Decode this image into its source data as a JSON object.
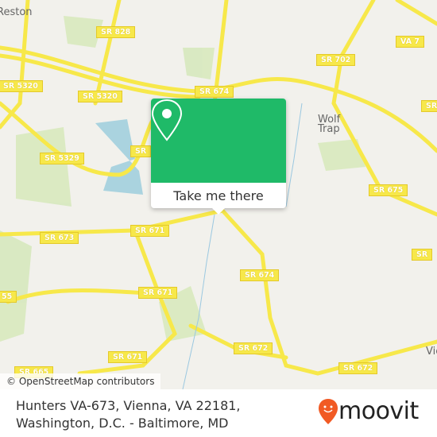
{
  "map": {
    "places": [
      {
        "label": "Reston"
      },
      {
        "label": "Wolf\nTrap"
      },
      {
        "label": "Vie"
      }
    ],
    "shields": [
      "SR 828",
      "VA 7",
      "SR 702",
      "SR 5320",
      "SR 5320",
      "SR 674",
      "SR",
      "SR 5329",
      "SR 675",
      "SR 673",
      "SR 671",
      "SR 674",
      "SR 671",
      "SR 672",
      "SR 671",
      "SR 672",
      "SR 665",
      "SR",
      "SR",
      "55"
    ],
    "attribution": "© OpenStreetMap contributors",
    "colors": {
      "road": "#f7e84a",
      "park": "#d4e8b8",
      "water": "#aad3df",
      "background": "#f2f1ec"
    }
  },
  "popup": {
    "cta_label": "Take me there",
    "pin_icon": "map-pin-icon",
    "color": "#1fba68"
  },
  "footer": {
    "address": "Hunters VA-673, Vienna, VA 22181, Washington, D.C. - Baltimore, MD",
    "brand": "moovit",
    "brand_color": "#f15a24"
  }
}
